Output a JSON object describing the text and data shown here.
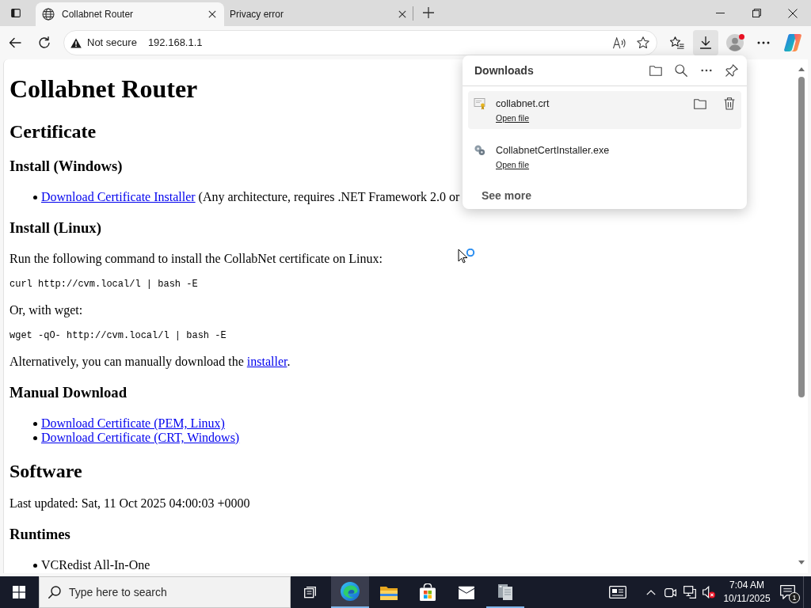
{
  "browser": {
    "tabs": [
      {
        "title": "Collabnet Router",
        "selected": true
      },
      {
        "title": "Privacy error",
        "selected": false
      }
    ],
    "address_bar": {
      "security_label": "Not secure",
      "url": "192.168.1.1"
    },
    "downloads_open": true
  },
  "page": {
    "blocks": [
      {
        "kind": "h1",
        "text": "Collabnet Router"
      },
      {
        "kind": "h2",
        "text": "Certificate"
      },
      {
        "kind": "h3",
        "text": "Install (Windows)"
      },
      {
        "kind": "list",
        "items": [
          [
            {
              "kind": "link",
              "text": "Download Certificate Installer"
            },
            {
              "kind": "text",
              "text": " (Any architecture, requires .NET Framework 2.0 or"
            }
          ]
        ]
      },
      {
        "kind": "h3",
        "text": "Install (Linux)"
      },
      {
        "kind": "p",
        "segments": [
          {
            "kind": "text",
            "text": "Run the following command to install the CollabNet certificate on Linux:"
          }
        ]
      },
      {
        "kind": "code",
        "text": "curl http://cvm.local/l | bash -E"
      },
      {
        "kind": "p",
        "segments": [
          {
            "kind": "text",
            "text": "Or, with wget:"
          }
        ]
      },
      {
        "kind": "code",
        "text": "wget -qO- http://cvm.local/l | bash -E"
      },
      {
        "kind": "p",
        "segments": [
          {
            "kind": "text",
            "text": "Alternatively, you can manually download the "
          },
          {
            "kind": "link",
            "text": "installer"
          },
          {
            "kind": "text",
            "text": "."
          }
        ]
      },
      {
        "kind": "h3",
        "text": "Manual Download"
      },
      {
        "kind": "list",
        "items": [
          [
            {
              "kind": "link",
              "text": "Download Certificate (PEM, Linux)"
            }
          ],
          [
            {
              "kind": "link",
              "text": "Download Certificate (CRT, Windows)"
            }
          ]
        ]
      },
      {
        "kind": "h2",
        "text": "Software"
      },
      {
        "kind": "p",
        "segments": [
          {
            "kind": "text",
            "text": "Last updated: Sat, 11 Oct 2025 04:00:03 +0000"
          }
        ]
      },
      {
        "kind": "h3",
        "text": "Runtimes"
      },
      {
        "kind": "list",
        "items": [
          [
            {
              "kind": "text",
              "text": "VCRedist All-In-One"
            }
          ]
        ]
      }
    ]
  },
  "downloads_panel": {
    "title": "Downloads",
    "items": [
      {
        "kind": "certificate",
        "file_name": "collabnet.crt",
        "action": "Open file",
        "hovered": true
      },
      {
        "kind": "installer",
        "file_name": "CollabnetCertInstaller.exe",
        "action": "Open file",
        "hovered": false
      }
    ],
    "see_more": "See more"
  },
  "taskbar": {
    "search_placeholder": "Type here to search",
    "apps": [
      {
        "kind": "edge",
        "running": true,
        "focused": true
      },
      {
        "kind": "explorer",
        "running": false,
        "focused": false
      },
      {
        "kind": "store",
        "running": false,
        "focused": false
      },
      {
        "kind": "mail",
        "running": false,
        "focused": false
      },
      {
        "kind": "server",
        "running": true,
        "focused": false
      }
    ],
    "time": "7:04 AM",
    "date": "10/11/2025",
    "notification_count": "1"
  }
}
